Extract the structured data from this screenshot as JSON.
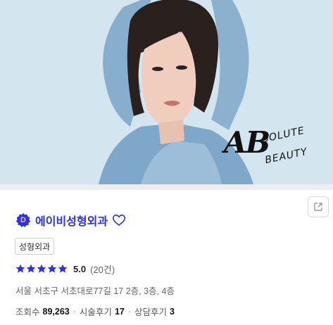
{
  "hero": {
    "logo_main": "AB",
    "logo_line1": "SOLUTE",
    "logo_line2": "BEAUTY"
  },
  "clinic": {
    "badge_letter": "D",
    "name": "에이비성형외과",
    "category": "성형외과",
    "rating": {
      "score": "5.0",
      "count_text": "(20건)",
      "stars_filled": 5,
      "stars_total": 5
    },
    "address": "서울 서초구 서초대로77길 17 2층, 3층, 4층",
    "stats": {
      "views_label": "조회수",
      "views_value": "89,263",
      "separator": "·",
      "procedure_reviews_label": "시술후기",
      "procedure_reviews_value": "17",
      "consult_reviews_label": "상담후기",
      "consult_reviews_value": "3"
    }
  },
  "icons": {
    "badge": "verified-badge-icon",
    "favorite": "heart-outline-icon",
    "share": "share-icon",
    "star": "star-icon"
  },
  "colors": {
    "brand_blue": "#2a2ff0",
    "star": "#2a2ff0",
    "badge_letter": "#f7c948"
  }
}
